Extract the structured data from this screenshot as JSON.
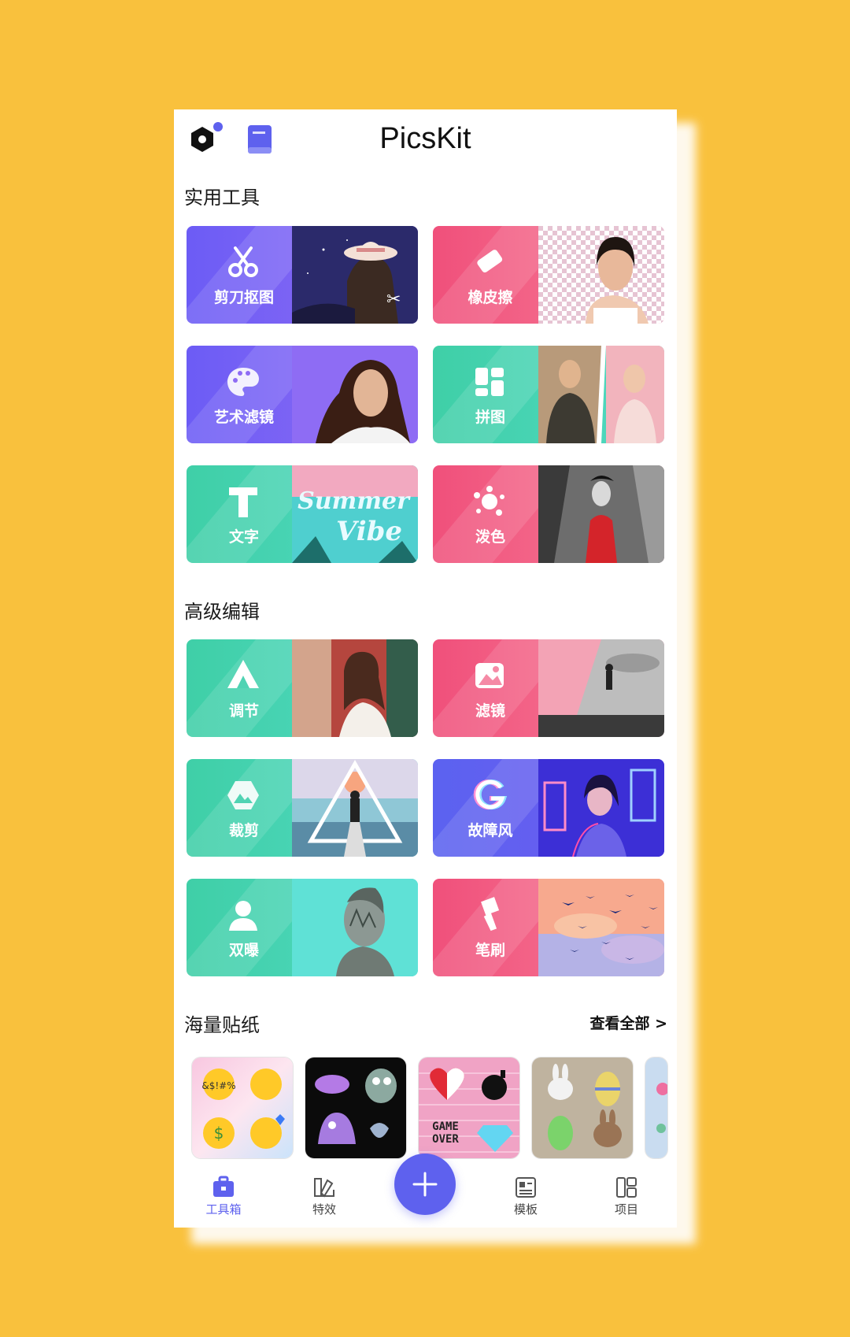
{
  "app": {
    "title": "PicsKit"
  },
  "header": {
    "logo_icon": "hexagon-settings-icon",
    "book_icon": "tutorial-book-icon"
  },
  "sections": {
    "tools": "实用工具",
    "advanced": "高级编辑",
    "stickers": "海量贴纸",
    "see_all": "查看全部 >"
  },
  "tools": [
    {
      "label": "剪刀抠图",
      "icon": "scissors-icon",
      "color": "#6C5CF5"
    },
    {
      "label": "橡皮擦",
      "icon": "eraser-icon",
      "color": "#F0507B"
    },
    {
      "label": "艺术滤镜",
      "icon": "palette-icon",
      "color": "#6C5CF5"
    },
    {
      "label": "拼图",
      "icon": "collage-icon",
      "color": "#3FCFA7"
    },
    {
      "label": "文字",
      "icon": "text-icon",
      "color": "#3FCFA7"
    },
    {
      "label": "泼色",
      "icon": "splash-icon",
      "color": "#F0507B"
    }
  ],
  "summer_text": [
    "Summer",
    "Vibe"
  ],
  "advanced": [
    {
      "label": "调节",
      "icon": "adjust-icon",
      "color": "#3FCFA7"
    },
    {
      "label": "滤镜",
      "icon": "filter-icon",
      "color": "#F0507B"
    },
    {
      "label": "裁剪",
      "icon": "crop-icon",
      "color": "#3FCFA7"
    },
    {
      "label": "故障风",
      "icon": "glitch-icon",
      "color": "#5B62F0"
    },
    {
      "label": "双曝",
      "icon": "double-exposure-icon",
      "color": "#3FCFA7"
    },
    {
      "label": "笔刷",
      "icon": "brush-icon",
      "color": "#F0507B"
    }
  ],
  "sticker_text": {
    "emoji_1": "&$!#%",
    "game": "GAME",
    "over": "OVER"
  },
  "nav": [
    {
      "label": "工具箱",
      "icon": "toolbox-icon",
      "active": true
    },
    {
      "label": "特效",
      "icon": "effects-icon",
      "active": false
    },
    {
      "label": "模板",
      "icon": "template-icon",
      "active": false
    },
    {
      "label": "项目",
      "icon": "project-icon",
      "active": false
    }
  ],
  "fab_icon": "plus-icon",
  "accent": "#5E61EE"
}
